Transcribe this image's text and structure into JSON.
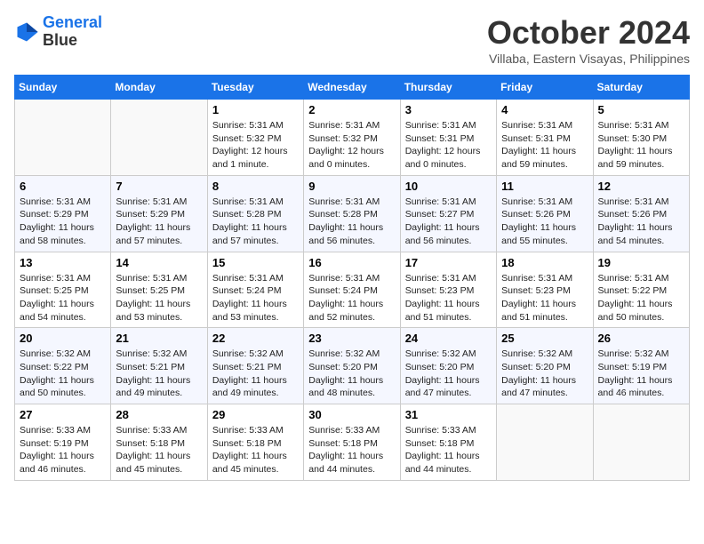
{
  "logo": {
    "line1": "General",
    "line2": "Blue"
  },
  "title": "October 2024",
  "location": "Villaba, Eastern Visayas, Philippines",
  "days_of_week": [
    "Sunday",
    "Monday",
    "Tuesday",
    "Wednesday",
    "Thursday",
    "Friday",
    "Saturday"
  ],
  "weeks": [
    [
      {
        "day": "",
        "sunrise": "",
        "sunset": "",
        "daylight": "",
        "empty": true
      },
      {
        "day": "",
        "sunrise": "",
        "sunset": "",
        "daylight": "",
        "empty": true
      },
      {
        "day": "1",
        "sunrise": "Sunrise: 5:31 AM",
        "sunset": "Sunset: 5:32 PM",
        "daylight": "Daylight: 12 hours and 1 minute.",
        "empty": false
      },
      {
        "day": "2",
        "sunrise": "Sunrise: 5:31 AM",
        "sunset": "Sunset: 5:32 PM",
        "daylight": "Daylight: 12 hours and 0 minutes.",
        "empty": false
      },
      {
        "day": "3",
        "sunrise": "Sunrise: 5:31 AM",
        "sunset": "Sunset: 5:31 PM",
        "daylight": "Daylight: 12 hours and 0 minutes.",
        "empty": false
      },
      {
        "day": "4",
        "sunrise": "Sunrise: 5:31 AM",
        "sunset": "Sunset: 5:31 PM",
        "daylight": "Daylight: 11 hours and 59 minutes.",
        "empty": false
      },
      {
        "day": "5",
        "sunrise": "Sunrise: 5:31 AM",
        "sunset": "Sunset: 5:30 PM",
        "daylight": "Daylight: 11 hours and 59 minutes.",
        "empty": false
      }
    ],
    [
      {
        "day": "6",
        "sunrise": "Sunrise: 5:31 AM",
        "sunset": "Sunset: 5:29 PM",
        "daylight": "Daylight: 11 hours and 58 minutes.",
        "empty": false
      },
      {
        "day": "7",
        "sunrise": "Sunrise: 5:31 AM",
        "sunset": "Sunset: 5:29 PM",
        "daylight": "Daylight: 11 hours and 57 minutes.",
        "empty": false
      },
      {
        "day": "8",
        "sunrise": "Sunrise: 5:31 AM",
        "sunset": "Sunset: 5:28 PM",
        "daylight": "Daylight: 11 hours and 57 minutes.",
        "empty": false
      },
      {
        "day": "9",
        "sunrise": "Sunrise: 5:31 AM",
        "sunset": "Sunset: 5:28 PM",
        "daylight": "Daylight: 11 hours and 56 minutes.",
        "empty": false
      },
      {
        "day": "10",
        "sunrise": "Sunrise: 5:31 AM",
        "sunset": "Sunset: 5:27 PM",
        "daylight": "Daylight: 11 hours and 56 minutes.",
        "empty": false
      },
      {
        "day": "11",
        "sunrise": "Sunrise: 5:31 AM",
        "sunset": "Sunset: 5:26 PM",
        "daylight": "Daylight: 11 hours and 55 minutes.",
        "empty": false
      },
      {
        "day": "12",
        "sunrise": "Sunrise: 5:31 AM",
        "sunset": "Sunset: 5:26 PM",
        "daylight": "Daylight: 11 hours and 54 minutes.",
        "empty": false
      }
    ],
    [
      {
        "day": "13",
        "sunrise": "Sunrise: 5:31 AM",
        "sunset": "Sunset: 5:25 PM",
        "daylight": "Daylight: 11 hours and 54 minutes.",
        "empty": false
      },
      {
        "day": "14",
        "sunrise": "Sunrise: 5:31 AM",
        "sunset": "Sunset: 5:25 PM",
        "daylight": "Daylight: 11 hours and 53 minutes.",
        "empty": false
      },
      {
        "day": "15",
        "sunrise": "Sunrise: 5:31 AM",
        "sunset": "Sunset: 5:24 PM",
        "daylight": "Daylight: 11 hours and 53 minutes.",
        "empty": false
      },
      {
        "day": "16",
        "sunrise": "Sunrise: 5:31 AM",
        "sunset": "Sunset: 5:24 PM",
        "daylight": "Daylight: 11 hours and 52 minutes.",
        "empty": false
      },
      {
        "day": "17",
        "sunrise": "Sunrise: 5:31 AM",
        "sunset": "Sunset: 5:23 PM",
        "daylight": "Daylight: 11 hours and 51 minutes.",
        "empty": false
      },
      {
        "day": "18",
        "sunrise": "Sunrise: 5:31 AM",
        "sunset": "Sunset: 5:23 PM",
        "daylight": "Daylight: 11 hours and 51 minutes.",
        "empty": false
      },
      {
        "day": "19",
        "sunrise": "Sunrise: 5:31 AM",
        "sunset": "Sunset: 5:22 PM",
        "daylight": "Daylight: 11 hours and 50 minutes.",
        "empty": false
      }
    ],
    [
      {
        "day": "20",
        "sunrise": "Sunrise: 5:32 AM",
        "sunset": "Sunset: 5:22 PM",
        "daylight": "Daylight: 11 hours and 50 minutes.",
        "empty": false
      },
      {
        "day": "21",
        "sunrise": "Sunrise: 5:32 AM",
        "sunset": "Sunset: 5:21 PM",
        "daylight": "Daylight: 11 hours and 49 minutes.",
        "empty": false
      },
      {
        "day": "22",
        "sunrise": "Sunrise: 5:32 AM",
        "sunset": "Sunset: 5:21 PM",
        "daylight": "Daylight: 11 hours and 49 minutes.",
        "empty": false
      },
      {
        "day": "23",
        "sunrise": "Sunrise: 5:32 AM",
        "sunset": "Sunset: 5:20 PM",
        "daylight": "Daylight: 11 hours and 48 minutes.",
        "empty": false
      },
      {
        "day": "24",
        "sunrise": "Sunrise: 5:32 AM",
        "sunset": "Sunset: 5:20 PM",
        "daylight": "Daylight: 11 hours and 47 minutes.",
        "empty": false
      },
      {
        "day": "25",
        "sunrise": "Sunrise: 5:32 AM",
        "sunset": "Sunset: 5:20 PM",
        "daylight": "Daylight: 11 hours and 47 minutes.",
        "empty": false
      },
      {
        "day": "26",
        "sunrise": "Sunrise: 5:32 AM",
        "sunset": "Sunset: 5:19 PM",
        "daylight": "Daylight: 11 hours and 46 minutes.",
        "empty": false
      }
    ],
    [
      {
        "day": "27",
        "sunrise": "Sunrise: 5:33 AM",
        "sunset": "Sunset: 5:19 PM",
        "daylight": "Daylight: 11 hours and 46 minutes.",
        "empty": false
      },
      {
        "day": "28",
        "sunrise": "Sunrise: 5:33 AM",
        "sunset": "Sunset: 5:18 PM",
        "daylight": "Daylight: 11 hours and 45 minutes.",
        "empty": false
      },
      {
        "day": "29",
        "sunrise": "Sunrise: 5:33 AM",
        "sunset": "Sunset: 5:18 PM",
        "daylight": "Daylight: 11 hours and 45 minutes.",
        "empty": false
      },
      {
        "day": "30",
        "sunrise": "Sunrise: 5:33 AM",
        "sunset": "Sunset: 5:18 PM",
        "daylight": "Daylight: 11 hours and 44 minutes.",
        "empty": false
      },
      {
        "day": "31",
        "sunrise": "Sunrise: 5:33 AM",
        "sunset": "Sunset: 5:18 PM",
        "daylight": "Daylight: 11 hours and 44 minutes.",
        "empty": false
      },
      {
        "day": "",
        "sunrise": "",
        "sunset": "",
        "daylight": "",
        "empty": true
      },
      {
        "day": "",
        "sunrise": "",
        "sunset": "",
        "daylight": "",
        "empty": true
      }
    ]
  ]
}
